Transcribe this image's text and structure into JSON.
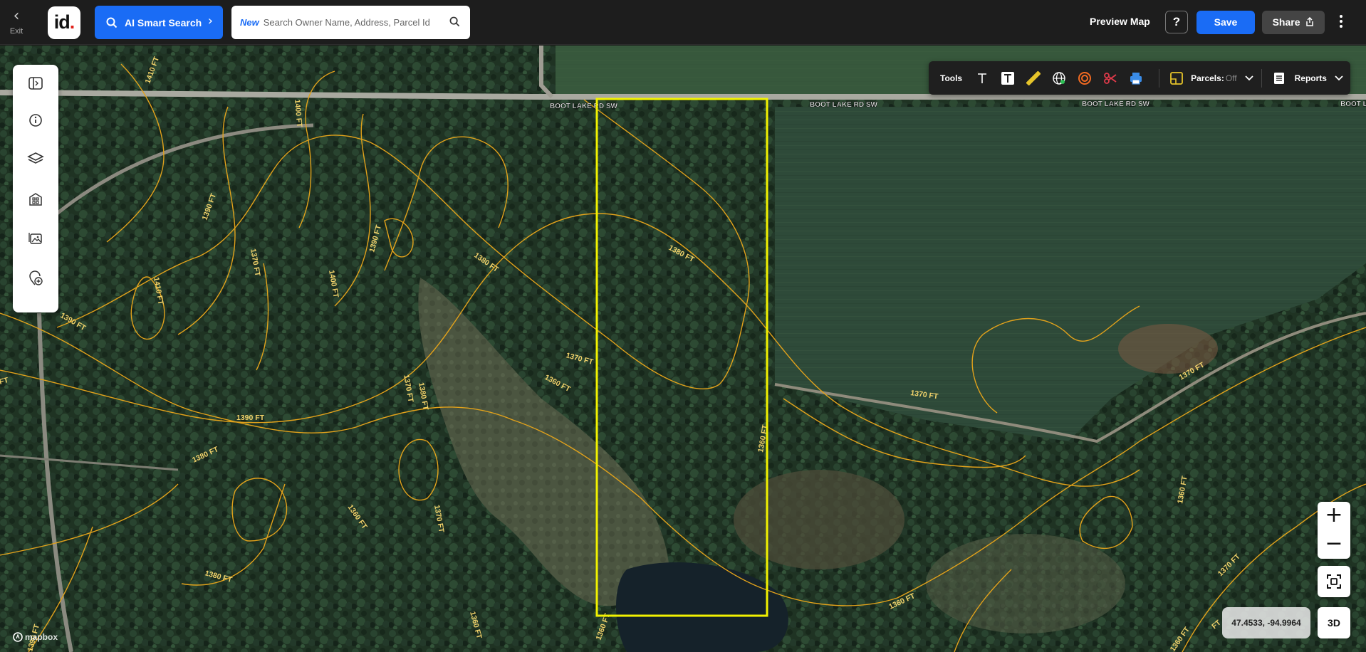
{
  "topbar": {
    "exit_label": "Exit",
    "logo_text": "id",
    "ai_search_label": "AI Smart Search",
    "search_new_badge": "New",
    "search_placeholder": "Search Owner Name, Address, Parcel Id",
    "preview_map_label": "Preview Map",
    "help_label": "?",
    "save_label": "Save",
    "share_label": "Share"
  },
  "tools": {
    "tools_label": "Tools",
    "parcels_label": "Parcels:",
    "parcels_state": "Off",
    "reports_label": "Reports"
  },
  "map": {
    "road_labels": [
      "BOOT LAKE RD SW",
      "BOOT LAKE RD SW",
      "BOOT LAKE RD SW",
      "BOOT L"
    ],
    "contour_labels": [
      "1410 FT",
      "1400 FT",
      "1390 FT",
      "1370 FT",
      "1400 FT",
      "1390 FT",
      "1380 FT",
      "1410 FT",
      "1390 FT",
      "1370 FT",
      "1360 FT",
      "1380 FT",
      "1370 FT",
      "1380 FT",
      "1390 FT",
      "1380 FT",
      "1360 FT",
      "1370 FT",
      "1380 FT",
      "1360 FT",
      "1370 FT",
      "1360 FT",
      "1360 FT",
      "1360 FT",
      "1370 FT",
      "1360 FT",
      "1370 FT",
      "1390 FT",
      "FT",
      "FT",
      "1360 FT"
    ],
    "parcel_color": "#f2f200",
    "contour_color": "#e2a21b",
    "coordinates": "47.4533, -94.9964",
    "zoom_in": "+",
    "zoom_out": "−",
    "three_d_label": "3D",
    "attribution": "mapbox"
  }
}
